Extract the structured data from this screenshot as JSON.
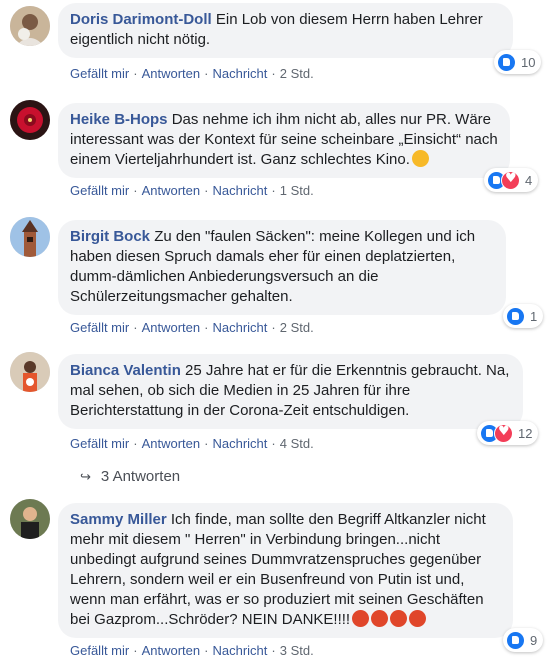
{
  "comments": [
    {
      "author": "Doris Darimont-Doll",
      "text": "Ein Lob von diesem Herrn haben Lehrer eigentlich nicht nötig.",
      "actions": {
        "like": "Gefällt mir",
        "reply": "Antworten",
        "message": "Nachricht",
        "time": "2 Std."
      },
      "reactions": {
        "icons": [
          "like-icon"
        ],
        "count": "10"
      }
    },
    {
      "author": "Heike B-Hops",
      "text": "Das nehme ich ihm nicht ab, alles nur PR. Wäre interessant was der Kontext für seine scheinbare „Einsicht“ nach einem Vierteljahrhundert ist. Ganz schlechtes Kino.",
      "emoji": "winking-face-kiss-emoji",
      "actions": {
        "like": "Gefällt mir",
        "reply": "Antworten",
        "message": "Nachricht",
        "time": "1 Std."
      },
      "reactions": {
        "icons": [
          "like-icon",
          "love-icon"
        ],
        "count": "4"
      }
    },
    {
      "author": "Birgit Bock",
      "text": "Zu den \"faulen Säcken\": meine Kollegen und ich haben diesen Spruch damals eher für einen deplatzierten, dumm-dämlichen Anbiederungsversuch an die Schülerzeitungsmacher gehalten.",
      "actions": {
        "like": "Gefällt mir",
        "reply": "Antworten",
        "message": "Nachricht",
        "time": "2 Std."
      },
      "reactions": {
        "icons": [
          "like-icon"
        ],
        "count": "1"
      }
    },
    {
      "author": "Bianca Valentin",
      "text": "25 Jahre hat er für die Erkenntnis gebraucht. Na, mal sehen, ob sich die Medien in 25 Jahren für ihre Berichterstattung in der Corona-Zeit entschuldigen.",
      "actions": {
        "like": "Gefällt mir",
        "reply": "Antworten",
        "message": "Nachricht",
        "time": "4 Std."
      },
      "reactions": {
        "icons": [
          "like-icon",
          "love-icon"
        ],
        "count": "12"
      }
    },
    {
      "author": "Sammy Miller",
      "text": "Ich finde, man sollte den Begriff Altkanzler nicht mehr mit diesem \" Herren\" in Verbindung bringen...nicht unbedingt aufgrund seines Dummvratzenspruches gegenüber Lehrern, sondern weil er ein Busenfreund von Putin ist und, wenn man erfährt, was er so produziert mit seinen Geschäften bei Gazprom...Schröder? NEIN DANKE!!!!",
      "emoji": "angry-face-emoji",
      "actions": {
        "like": "Gefällt mir",
        "reply": "Antworten",
        "message": "Nachricht",
        "time": "3 Std."
      },
      "reactions": {
        "icons": [
          "like-icon"
        ],
        "count": "9"
      }
    }
  ],
  "replies_link": "3 Antworten",
  "colors": {
    "author": "#385898",
    "bubble": "#f2f3f5",
    "like": "#1877f2",
    "love": "#f33e58",
    "meta": "#606770"
  }
}
